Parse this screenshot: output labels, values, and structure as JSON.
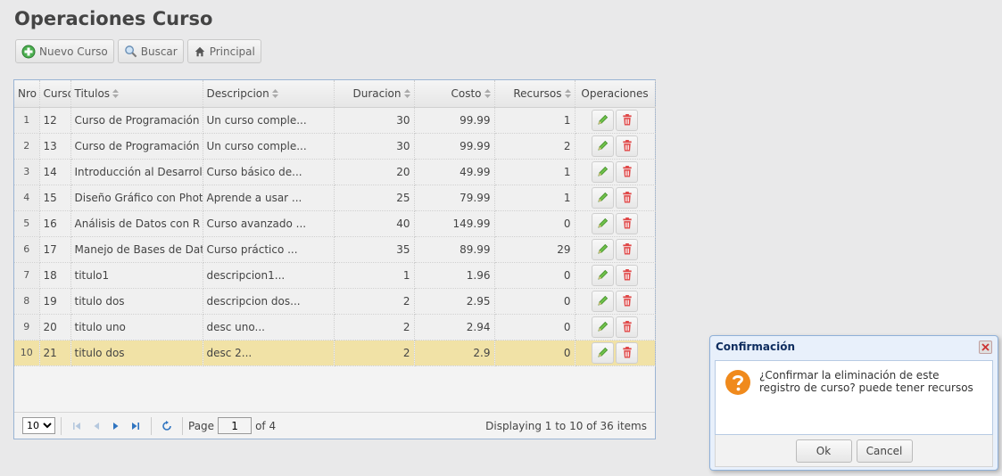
{
  "page": {
    "title": "Operaciones Curso"
  },
  "toolbar": {
    "new_label": "Nuevo Curso",
    "search_label": "Buscar",
    "home_label": "Principal"
  },
  "grid": {
    "headers": {
      "nro": "Nro",
      "curso": "Curso",
      "titulos": "Titulos",
      "descripcion": "Descripcion",
      "duracion": "Duracion",
      "costo": "Costo",
      "recursos": "Recursos",
      "operaciones": "Operaciones"
    },
    "rows": [
      {
        "nro": "1",
        "curso": "12",
        "titulo": "Curso de Programación en",
        "descripcion": "Un curso comple...",
        "duracion": "30",
        "costo": "99.99",
        "recursos": "1"
      },
      {
        "nro": "2",
        "curso": "13",
        "titulo": "Curso de Programación en",
        "descripcion": "Un curso comple...",
        "duracion": "30",
        "costo": "99.99",
        "recursos": "2"
      },
      {
        "nro": "3",
        "curso": "14",
        "titulo": "Introducción al Desarrollo",
        "descripcion": "Curso básico de...",
        "duracion": "20",
        "costo": "49.99",
        "recursos": "1"
      },
      {
        "nro": "4",
        "curso": "15",
        "titulo": "Diseño Gráfico con Photo",
        "descripcion": "Aprende a usar ...",
        "duracion": "25",
        "costo": "79.99",
        "recursos": "1"
      },
      {
        "nro": "5",
        "curso": "16",
        "titulo": "Análisis de Datos con R",
        "descripcion": "Curso avanzado ...",
        "duracion": "40",
        "costo": "149.99",
        "recursos": "0"
      },
      {
        "nro": "6",
        "curso": "17",
        "titulo": "Manejo de Bases de Datos",
        "descripcion": "Curso práctico ...",
        "duracion": "35",
        "costo": "89.99",
        "recursos": "29"
      },
      {
        "nro": "7",
        "curso": "18",
        "titulo": "titulo1",
        "descripcion": "descripcion1...",
        "duracion": "1",
        "costo": "1.96",
        "recursos": "0"
      },
      {
        "nro": "8",
        "curso": "19",
        "titulo": "titulo dos",
        "descripcion": "descripcion dos...",
        "duracion": "2",
        "costo": "2.95",
        "recursos": "0"
      },
      {
        "nro": "9",
        "curso": "20",
        "titulo": "titulo uno",
        "descripcion": "desc uno...",
        "duracion": "2",
        "costo": "2.94",
        "recursos": "0"
      },
      {
        "nro": "10",
        "curso": "21",
        "titulo": "titulo dos",
        "descripcion": "desc 2...",
        "duracion": "2",
        "costo": "2.9",
        "recursos": "0"
      }
    ],
    "selected_row": 10
  },
  "pager": {
    "page_size": "10",
    "page_label": "Page",
    "page_value": "1",
    "of_label": "of 4",
    "info": "Displaying 1 to 10 of 36 items"
  },
  "dialog": {
    "title": "Confirmación",
    "message": "¿Confirmar la eliminación de este registro de curso? puede tener recursos",
    "ok_label": "Ok",
    "cancel_label": "Cancel"
  },
  "colors": {
    "selected_row": "#f1e2a6",
    "grid_border": "#9ab4d4",
    "dialog_title": "#0e2d5f",
    "edit_icon": "#4a9e3a",
    "delete_icon": "#e04848",
    "question_icon": "#f08a1c"
  },
  "icons": {
    "new": "plus-circle-icon",
    "search": "magnifier-icon",
    "home": "home-icon",
    "edit": "pencil-icon",
    "delete": "trash-icon",
    "first": "first-page-icon",
    "prev": "prev-page-icon",
    "next": "next-page-icon",
    "last": "last-page-icon",
    "refresh": "refresh-icon",
    "question": "question-icon",
    "close": "close-icon"
  }
}
